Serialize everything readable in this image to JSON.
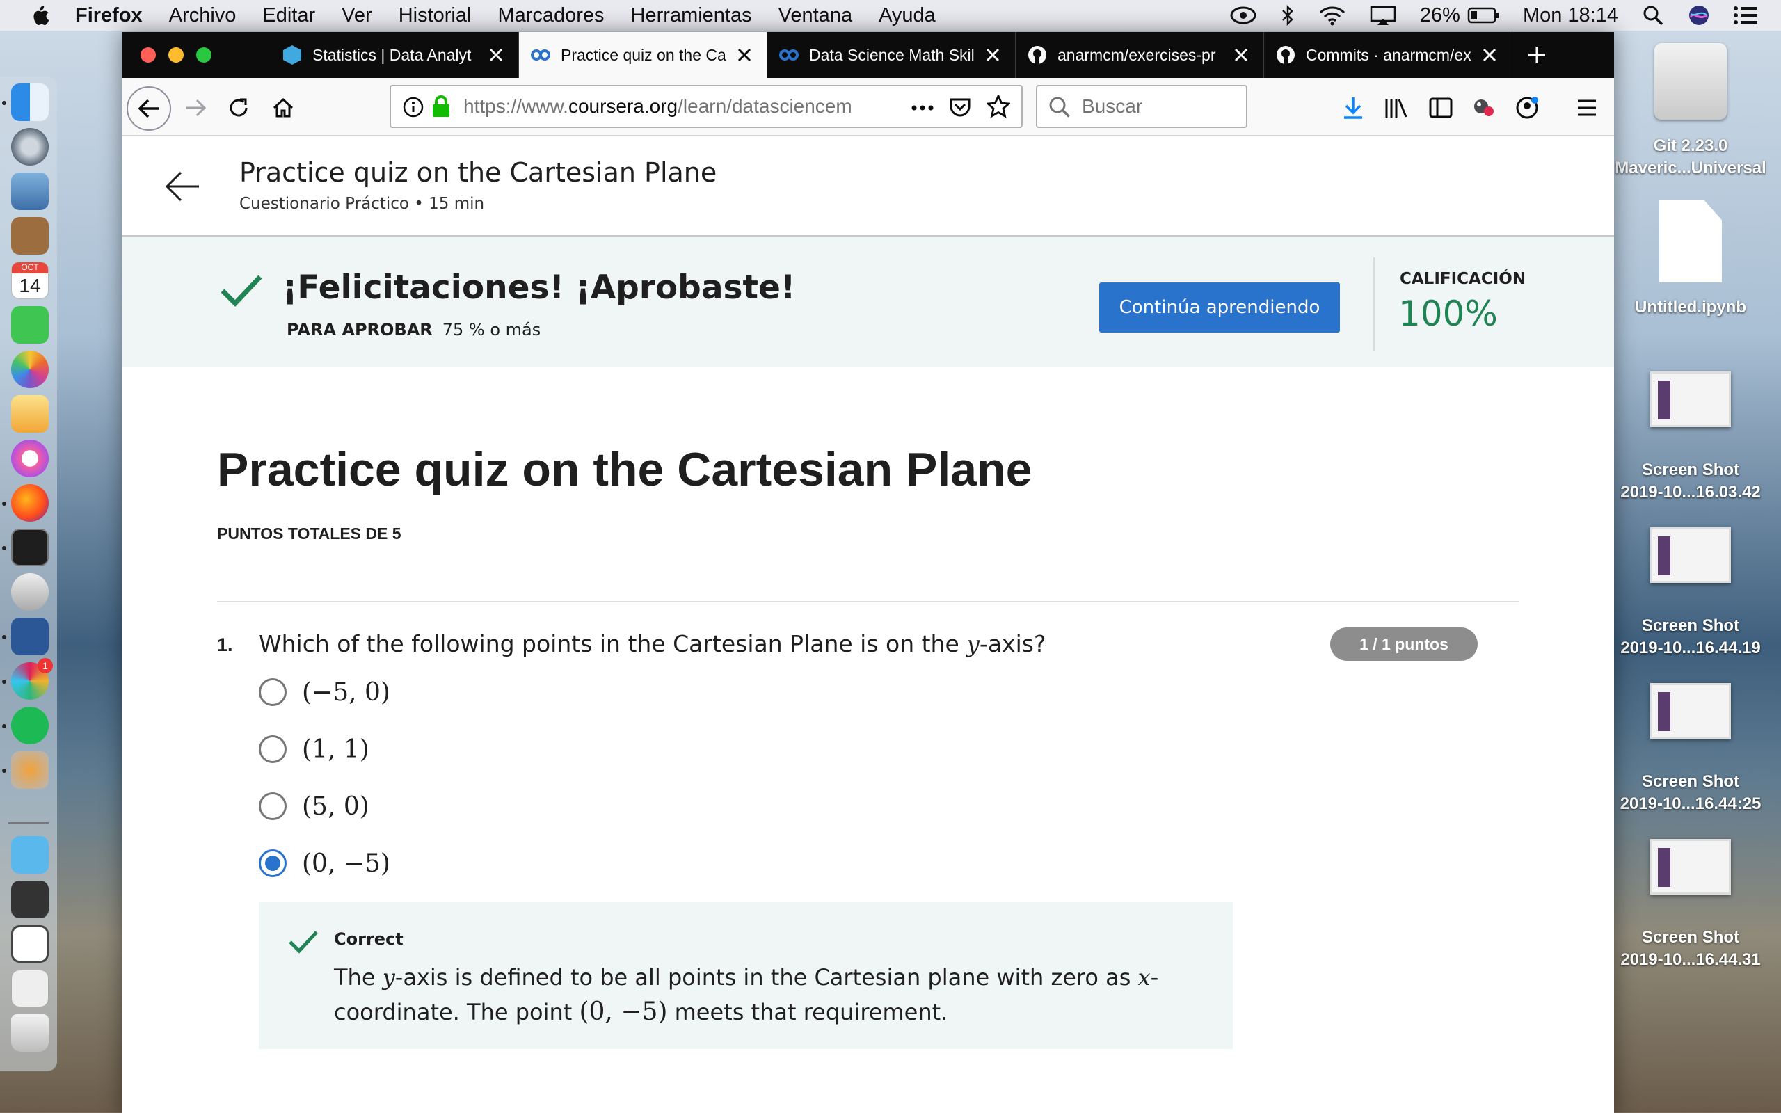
{
  "menubar": {
    "app": "Firefox",
    "items": [
      "Archivo",
      "Editar",
      "Ver",
      "Historial",
      "Marcadores",
      "Herramientas",
      "Ventana",
      "Ayuda"
    ],
    "battery": "26%",
    "clock": "Mon 18:14"
  },
  "browser": {
    "tabs": [
      {
        "title": "Statistics | Data Analyt",
        "icon": "statistics-favicon"
      },
      {
        "title": "Practice quiz on the Ca",
        "icon": "coursera-favicon",
        "active": true
      },
      {
        "title": "Data Science Math Skil",
        "icon": "coursera-favicon"
      },
      {
        "title": "anarmcm/exercises-pr",
        "icon": "github-favicon"
      },
      {
        "title": "Commits · anarmcm/ex",
        "icon": "github-favicon"
      }
    ],
    "url_prefix": "https://www.",
    "url_domain": "coursera.org",
    "url_rest": "/learn/datasciencem",
    "search_placeholder": "Buscar"
  },
  "page_header": {
    "title": "Practice quiz on the Cartesian Plane",
    "subtitle": "Cuestionario Práctico • 15 min"
  },
  "result": {
    "headline": "¡Felicitaciones! ¡Aprobaste!",
    "pass_label": "PARA APROBAR",
    "pass_value": "75 % o más",
    "continue_button": "Continúa aprendiendo",
    "grade_label": "CALIFICACIÓN",
    "grade_value": "100%"
  },
  "quiz": {
    "title": "Practice quiz on the Cartesian Plane",
    "total_points": "PUNTOS TOTALES DE 5",
    "question": {
      "number": "1.",
      "text_before": "Which of the following points in the Cartesian Plane is on the ",
      "var": "y",
      "text_after": "-axis?",
      "points": "1 / 1 puntos",
      "options": [
        "(−5, 0)",
        "(1, 1)",
        "(5, 0)",
        "(0, −5)"
      ],
      "selected_index": 3,
      "feedback_title": "Correct",
      "feedback_1": "The ",
      "feedback_var_y": "y",
      "feedback_2": "-axis is defined to be all points in the Cartesian plane with zero as ",
      "feedback_var_x": "x",
      "feedback_3": "-coordinate. The point ",
      "feedback_point": "(0, −5)",
      "feedback_4": " meets that requirement."
    }
  },
  "desktop": {
    "items": [
      {
        "label": "Git 2.23.0\nMaveric...Universal",
        "icon": "disk-icon"
      },
      {
        "label": "Untitled.ipynb",
        "icon": "document-icon"
      },
      {
        "label": "Screen Shot\n2019-10...16.03.42",
        "icon": "screenshot-icon"
      },
      {
        "label": "Screen Shot\n2019-10...16.44.19",
        "icon": "screenshot-icon"
      },
      {
        "label": "Screen Shot\n2019-10...16.44:25",
        "icon": "screenshot-icon"
      },
      {
        "label": "Screen Shot\n2019-10...16.44.31",
        "icon": "screenshot-icon"
      }
    ]
  },
  "dock": {
    "calendar_month": "OCT",
    "calendar_day": "14",
    "slack_badge": "1"
  }
}
